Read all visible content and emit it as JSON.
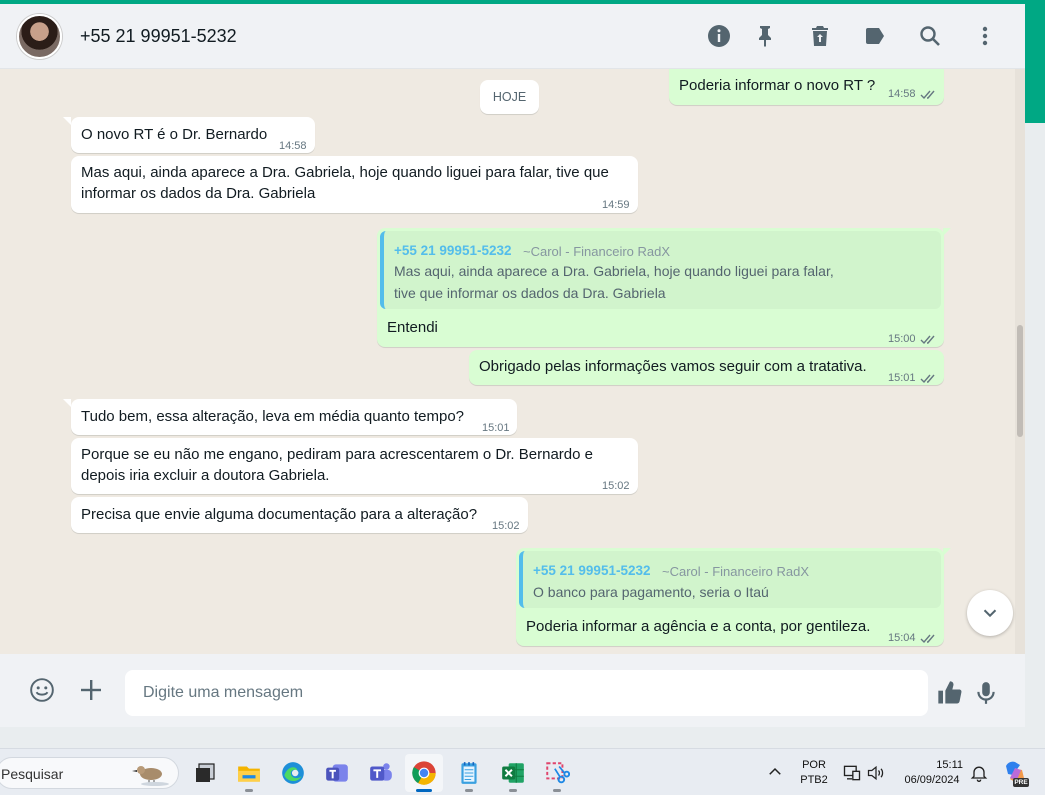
{
  "header": {
    "contact": "+55 21 99951-5232",
    "icons": [
      "info-icon",
      "pin-icon",
      "delete-icon",
      "label-icon",
      "search-icon",
      "menu-icon"
    ]
  },
  "chat": {
    "date_chip": "HOJE",
    "messages": [
      {
        "dir": "out",
        "text": "Poderia informar o novo RT ?",
        "time": "14:58",
        "ticks": true
      },
      {
        "dir": "in",
        "text": "O novo RT é o Dr. Bernardo",
        "time": "14:58"
      },
      {
        "dir": "in",
        "text": "Mas aqui, ainda aparece a Dra. Gabriela, hoje quando liguei para falar, tive que informar os dados da Dra. Gabriela",
        "time": "14:59"
      },
      {
        "dir": "out",
        "quote": {
          "author": "+55 21 99951-5232",
          "push": "~Carol - Financeiro RadX",
          "text": "Mas aqui, ainda aparece a Dra. Gabriela, hoje quando liguei para falar, tive que informar os dados da Dra. Gabriela"
        },
        "text": "Entendi",
        "time": "15:00",
        "ticks": true
      },
      {
        "dir": "out",
        "text": "Obrigado pelas informações vamos seguir com a tratativa.",
        "time": "15:01",
        "ticks": true
      },
      {
        "dir": "in",
        "text": "Tudo bem, essa alteração, leva em média quanto tempo?",
        "time": "15:01"
      },
      {
        "dir": "in",
        "text": "Porque se eu não me engano, pediram para acrescentarem o Dr. Bernardo e depois iria excluir a doutora Gabriela.",
        "time": "15:02"
      },
      {
        "dir": "in",
        "text": "Precisa que envie alguma documentação para a alteração?",
        "time": "15:02"
      },
      {
        "dir": "out",
        "quote": {
          "author": "+55 21 99951-5232",
          "push": "~Carol - Financeiro RadX",
          "text": "O banco para pagamento, seria o Itaú"
        },
        "text": "Poderia informar a agência e a conta, por gentileza.",
        "time": "15:04",
        "ticks": true
      }
    ]
  },
  "composer": {
    "placeholder": "Digite uma mensagem"
  },
  "taskbar": {
    "search": "Pesquisar",
    "lang": "POR",
    "layout": "PTB2",
    "time": "15:11",
    "date": "06/09/2024",
    "copilot_badge": "PRE"
  },
  "colors": {
    "accent": "#00a884",
    "bubble_out": "#d9fdd3",
    "bubble_in": "#ffffff",
    "quote_author": "#53bdeb",
    "chat_bg": "#efeae2"
  }
}
